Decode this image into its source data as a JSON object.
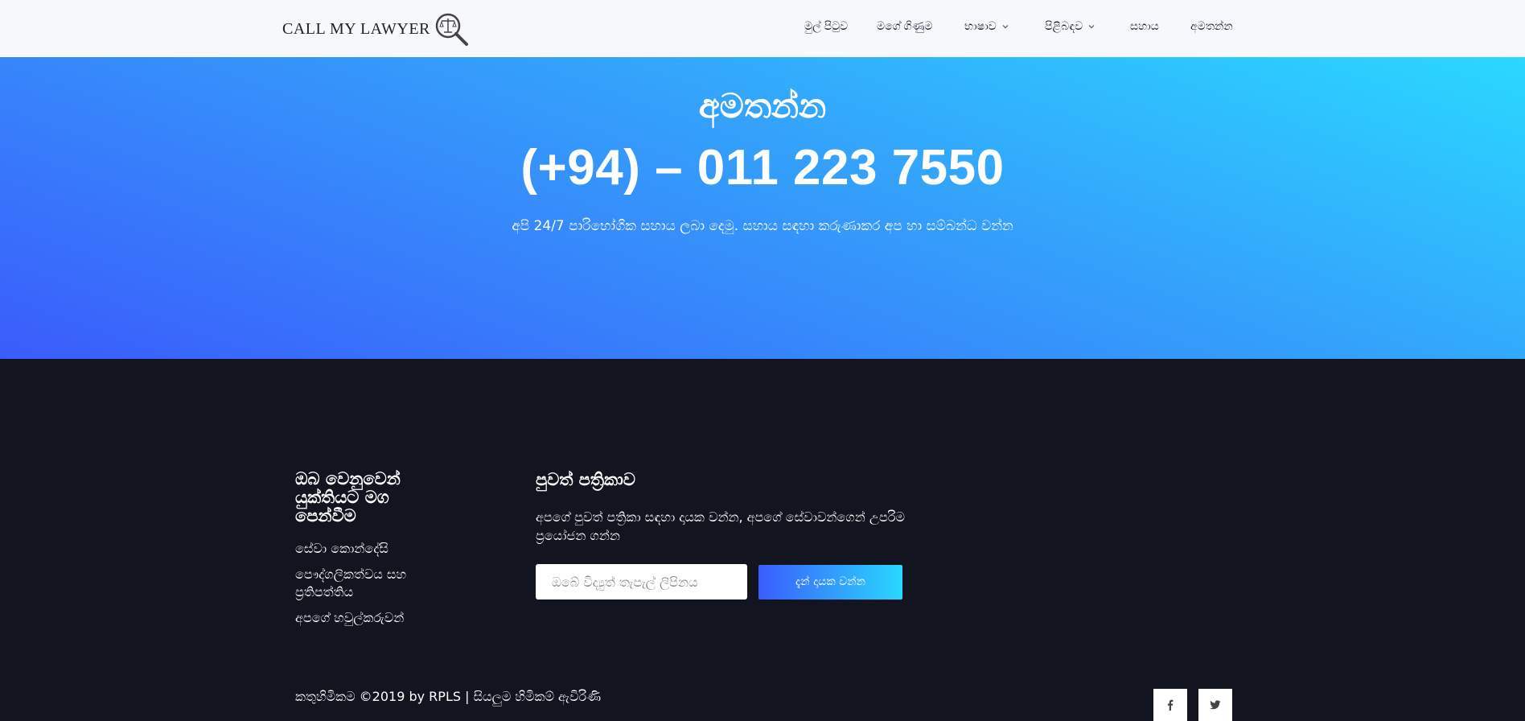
{
  "header": {
    "logo_text": "CALL MY LAWYER",
    "nav": [
      {
        "label": "මුල් පිටුව"
      },
      {
        "label": "මගේ ගිණුම"
      },
      {
        "label": "භාෂාව"
      },
      {
        "label": "පිළිබඳව"
      },
      {
        "label": "සහාය"
      },
      {
        "label": "අමතන්න"
      }
    ]
  },
  "hero": {
    "title": "අමතන්න",
    "phone": "(+94) – 011 223 7550",
    "subtitle": "අපි 24/7 පාරිභෝගික සහාය ලබා දෙමු. සහාය සඳහා කරුණාකර අප හා සම්බන්ධ වන්න"
  },
  "footer": {
    "tagline": "ඔබ වෙනුවෙන් යුක්තියට මග පෙන්වීම",
    "links": [
      {
        "label": "සේවා කොන්දේසි"
      },
      {
        "label": "පෞද්ගලිකත්වය සහ ප්‍රතිපත්තිය"
      },
      {
        "label": "අපගේ හවුල්කරුවන්"
      }
    ],
    "newsletter": {
      "title": "පුවත් පත්‍රිකාව",
      "text": "අපගේ පුවත් පත්‍රිකා සඳහා දායක වන්න, අපගේ සේවාවන්ගෙන් උපරිම ප්‍රයෝජන ගන්න",
      "email_placeholder": "ඔබේ විද්‍යුත් තැපැල් ලිපිනය",
      "button_label": "දැන් දායක වන්න"
    },
    "copyright": "කතුහිමිකම ©2019 by RPLS | සියලුම හිමිකම් ඇවිරිණි",
    "social": [
      {
        "icon": "facebook-icon"
      },
      {
        "icon": "twitter-icon"
      }
    ]
  },
  "colors": {
    "hero_gradient_start": "#2ad8ff",
    "hero_gradient_end": "#3a5cfb",
    "footer_bg": "#12151f",
    "nav_bg": "#f7f8fc"
  }
}
